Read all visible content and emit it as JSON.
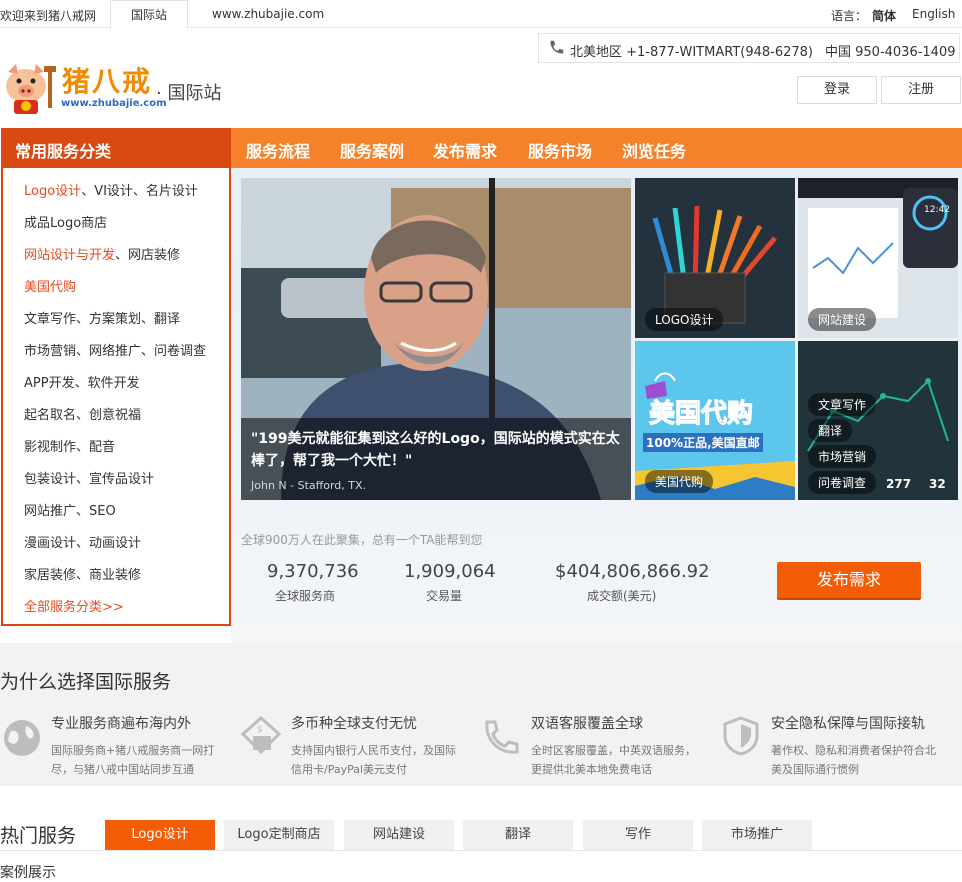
{
  "topbar": {
    "welcome": "欢迎来到猪八戒网",
    "tab_intl": "国际站",
    "tab_site": "www.zhubajie.com",
    "lang_label": "语言：",
    "lang_cn": "简体",
    "lang_en": "English"
  },
  "header": {
    "phone_na": "北美地区 +1-877-WITMART(948-6278)",
    "phone_cn": "中国 950-4036-1409",
    "logo_text": "猪八戒",
    "logo_url": "www.zhubajie.com",
    "site_sub": "· 国际站",
    "login": "登录",
    "register": "注册"
  },
  "nav": {
    "items": [
      "服务流程",
      "服务案例",
      "发布需求",
      "服务市场",
      "浏览任务"
    ]
  },
  "sidebar": {
    "title": "常用服务分类",
    "items": [
      {
        "hl": "Logo设计",
        "rest": "、VI设计、名片设计"
      },
      {
        "hl": "",
        "rest": "成品Logo商店"
      },
      {
        "hl": "网站设计与开发",
        "rest": "、网店装修"
      },
      {
        "hl": "美国代购",
        "rest": ""
      },
      {
        "hl": "",
        "rest": "文章写作、方案策划、翻译"
      },
      {
        "hl": "",
        "rest": "市场营销、网络推广、问卷调查"
      },
      {
        "hl": "",
        "rest": "APP开发、软件开发"
      },
      {
        "hl": "",
        "rest": "起名取名、创意祝福"
      },
      {
        "hl": "",
        "rest": "影视制作、配音"
      },
      {
        "hl": "",
        "rest": "包装设计、宣传品设计"
      },
      {
        "hl": "",
        "rest": "网站推广、SEO"
      },
      {
        "hl": "",
        "rest": "漫画设计、动画设计"
      },
      {
        "hl": "",
        "rest": "家居装修、商业装修"
      },
      {
        "hl": "全部服务分类>>",
        "rest": ""
      }
    ]
  },
  "hero": {
    "quote": "\"199美元就能征集到这么好的Logo，国际站的模式实在太棒了，帮了我一个大忙！\"",
    "author": "John N - Stafford, TX."
  },
  "tiles": {
    "logo": "LOGO设计",
    "web": "网站建设",
    "daigou_banner": "美国代购",
    "daigou_banner_sub": "100%正品,美国直邮",
    "daigou": "美国代购",
    "writing": "文章写作",
    "translate": "翻译",
    "marketing": "市场营销",
    "survey": "问卷调查",
    "chart_num1": "277",
    "chart_num2": "32",
    "time": "12:42"
  },
  "stats": {
    "caption": "全球900万人在此聚集，总有一个TA能帮到您",
    "items": [
      {
        "value": "9,370,736",
        "label": "全球服务商"
      },
      {
        "value": "1,909,064",
        "label": "交易量"
      },
      {
        "value": "$404,806,866.92",
        "label": "成交额(美元)"
      }
    ],
    "publish": "发布需求"
  },
  "why": {
    "title": "为什么选择国际服务",
    "items": [
      {
        "icon": "globe-icon",
        "title": "专业服务商遍布海内外",
        "desc1": "国际服务商+猪八戒服务商一网打",
        "desc2": "尽，与猪八戒中国站同步互通"
      },
      {
        "icon": "payment-icon",
        "title": "多币种全球支付无忧",
        "desc1": "支持国内银行人民币支付，及国际",
        "desc2": "信用卡/PayPal美元支付"
      },
      {
        "icon": "phone-icon",
        "title": "双语客服覆盖全球",
        "desc1": "全时区客服覆盖，中英双语服务，",
        "desc2": "更提供北美本地免费电话"
      },
      {
        "icon": "shield-icon",
        "title": "安全隐私保障与国际接轨",
        "desc1": "著作权、隐私和消费者保护符合北",
        "desc2": "美及国际通行惯例"
      }
    ]
  },
  "hot": {
    "title": "热门服务",
    "tabs": [
      "Logo设计",
      "Logo定制商店",
      "网站建设",
      "翻译",
      "写作",
      "市场推广"
    ],
    "case_title": "案例展示"
  },
  "colors": {
    "nav_orange": "#f5822a",
    "side_red": "#d94a12",
    "accent": "#f45d08"
  }
}
